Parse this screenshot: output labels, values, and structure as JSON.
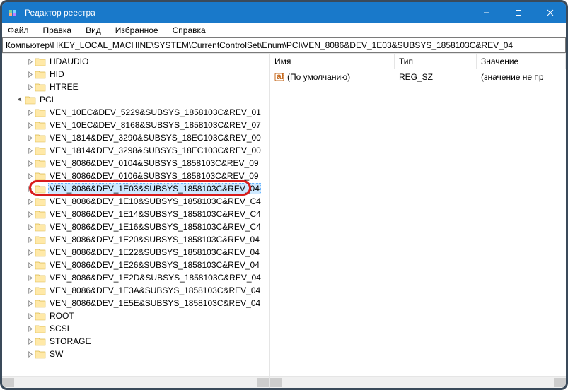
{
  "titlebar": {
    "title": "Редактор реестра"
  },
  "menu": {
    "file": "Файл",
    "edit": "Правка",
    "view": "Вид",
    "favorites": "Избранное",
    "help": "Справка"
  },
  "address": "Компьютер\\HKEY_LOCAL_MACHINE\\SYSTEM\\CurrentControlSet\\Enum\\PCI\\VEN_8086&DEV_1E03&SUBSYS_1858103C&REV_04",
  "tree": {
    "top": [
      {
        "label": "HDAUDIO",
        "exp": true,
        "indent": 2
      },
      {
        "label": "HID",
        "exp": true,
        "indent": 2
      },
      {
        "label": "HTREE",
        "exp": true,
        "indent": 2
      }
    ],
    "pci_label": "PCI",
    "pci_children": [
      "VEN_10EC&DEV_5229&SUBSYS_1858103C&REV_01",
      "VEN_10EC&DEV_8168&SUBSYS_1858103C&REV_07",
      "VEN_1814&DEV_3290&SUBSYS_18EC103C&REV_00",
      "VEN_1814&DEV_3298&SUBSYS_18EC103C&REV_00",
      "VEN_8086&DEV_0104&SUBSYS_1858103C&REV_09",
      "VEN_8086&DEV_0106&SUBSYS_1858103C&REV_09",
      "VEN_8086&DEV_1E03&SUBSYS_1858103C&REV_04",
      "VEN_8086&DEV_1E10&SUBSYS_1858103C&REV_C4",
      "VEN_8086&DEV_1E14&SUBSYS_1858103C&REV_C4",
      "VEN_8086&DEV_1E16&SUBSYS_1858103C&REV_C4",
      "VEN_8086&DEV_1E20&SUBSYS_1858103C&REV_04",
      "VEN_8086&DEV_1E22&SUBSYS_1858103C&REV_04",
      "VEN_8086&DEV_1E26&SUBSYS_1858103C&REV_04",
      "VEN_8086&DEV_1E2D&SUBSYS_1858103C&REV_04",
      "VEN_8086&DEV_1E3A&SUBSYS_1858103C&REV_04",
      "VEN_8086&DEV_1E5E&SUBSYS_1858103C&REV_04"
    ],
    "selected_index": 6,
    "bottom": [
      {
        "label": "ROOT",
        "exp": true,
        "indent": 2
      },
      {
        "label": "SCSI",
        "exp": true,
        "indent": 2
      },
      {
        "label": "STORAGE",
        "exp": true,
        "indent": 2
      },
      {
        "label": "SW",
        "exp": true,
        "indent": 2
      }
    ]
  },
  "list": {
    "columns": {
      "name": "Имя",
      "type": "Тип",
      "value": "Значение"
    },
    "rows": [
      {
        "name": "(По умолчанию)",
        "type": "REG_SZ",
        "value": "(значение не пр"
      }
    ]
  }
}
